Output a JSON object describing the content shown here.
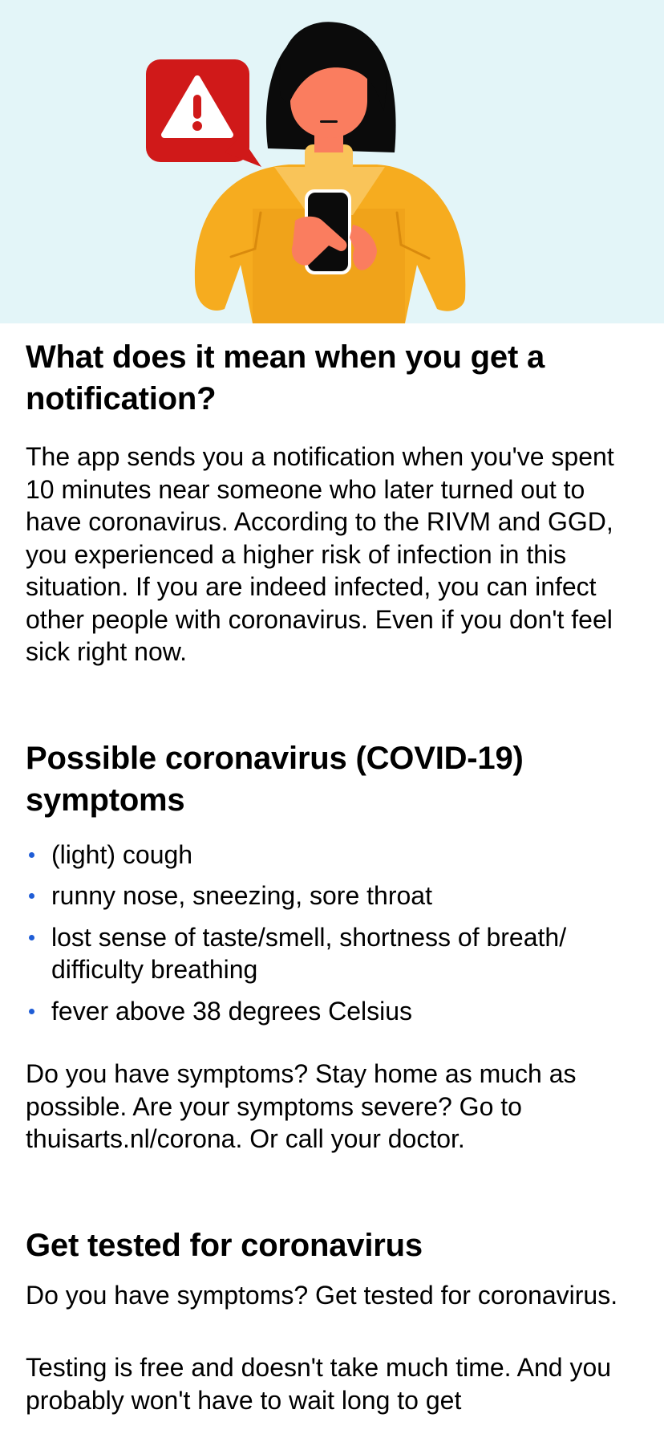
{
  "sections": {
    "notification": {
      "title": "What does it mean when you get a notification?",
      "body": "The app sends you a notification when you've spent 10 minutes near someone who later turned out to have coronavirus. According to the RIVM and GGD, you experienced a higher risk of infection in this situation. If you are indeed infected, you can infect other people with coronavirus. Even if you don't feel sick right now."
    },
    "symptoms": {
      "title": "Possible coronavirus (COVID-19) symptoms",
      "items": [
        "(light) cough",
        "runny nose, sneezing, sore throat",
        "lost sense of taste/smell, shortness of breath/ difficulty breathing",
        "fever above 38 degrees Celsius"
      ],
      "advice": "Do you have symptoms? Stay home as much as possible. Are your symptoms severe? Go to thuisarts.nl/corona. Or call your doctor."
    },
    "testing": {
      "title": "Get tested for coronavirus",
      "body1": "Do you have symptoms? Get tested for coronavirus.",
      "body2": "Testing is free and doesn't take much time. And you probably won't have to wait long to get"
    }
  },
  "colors": {
    "hero_background": "#e3f5f8",
    "bullet": "#1f5dd6",
    "alert_red": "#d01919",
    "sweater": "#f6ac1f"
  },
  "illustration": {
    "icons": [
      "warning-icon",
      "person-with-phone-illustration"
    ]
  }
}
